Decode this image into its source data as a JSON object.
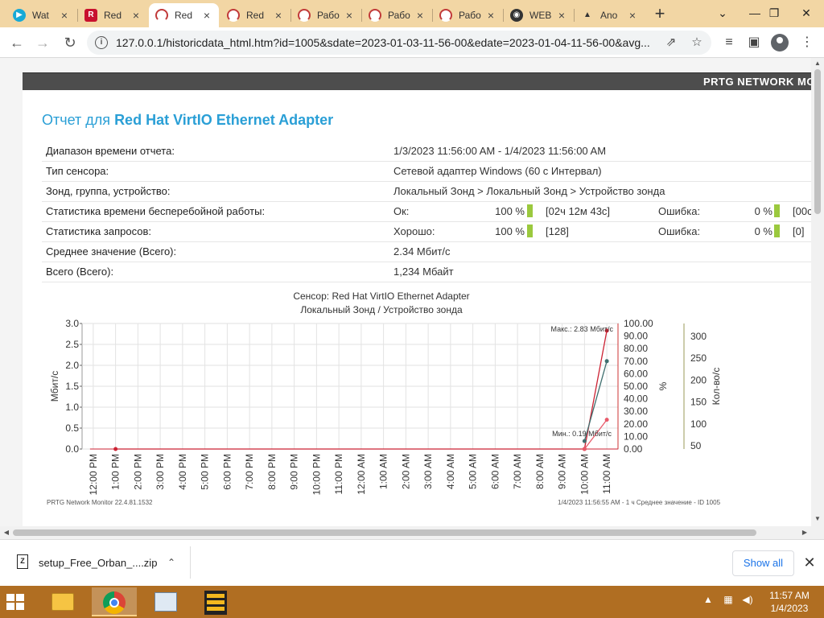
{
  "browser": {
    "tabs": [
      {
        "title": "Wat",
        "icon": "water-icon"
      },
      {
        "title": "Red",
        "icon": "redhat-icon"
      },
      {
        "title": "Red",
        "icon": "prtg-gauge-icon",
        "active": true
      },
      {
        "title": "Red",
        "icon": "prtg-gauge-icon"
      },
      {
        "title": "Рабо",
        "icon": "prtg-gauge-icon"
      },
      {
        "title": "Рабо",
        "icon": "prtg-gauge-icon"
      },
      {
        "title": "Рабо",
        "icon": "prtg-gauge-icon"
      },
      {
        "title": "WEB",
        "icon": "eye-icon"
      },
      {
        "title": "Ano",
        "icon": "triangle-logo-icon"
      }
    ],
    "url": "127.0.0.1/historicdata_html.htm?id=1005&sdate=2023-01-03-11-56-00&edate=2023-01-04-11-56-00&avg..."
  },
  "page": {
    "brand": "PRTG NETWORK MO",
    "title_prefix": "Отчет для",
    "title_name": "Red Hat VirtIO Ethernet Adapter",
    "rows": {
      "time_range": {
        "label": "Диапазон времени отчета:",
        "value": "1/3/2023 11:56:00 AM - 1/4/2023 11:56:00 AM"
      },
      "sensor_type": {
        "label": "Тип сенсора:",
        "value": "Сетевой адаптер Windows (60 с Интервал)"
      },
      "probe": {
        "label": "Зонд, группа, устройство:",
        "value": "Локальный Зонд > Локальный Зонд > Устройство зонда"
      },
      "uptime": {
        "label": "Статистика времени бесперебойной работы:",
        "ok_label": "Ок:",
        "ok_pct": "100 %",
        "ok_time": "[02ч 12м 43с]",
        "err_label": "Ошибка:",
        "err_pct": "0 %",
        "err_time": "[00с"
      },
      "requests": {
        "label": "Статистика запросов:",
        "ok_label": "Хорошо:",
        "ok_pct": "100 %",
        "ok_count": "[128]",
        "err_label": "Ошибка:",
        "err_pct": "0 %",
        "err_count": "[0]"
      },
      "average": {
        "label": "Среднее значение (Всего):",
        "value": "2.34 Мбит/с"
      },
      "total": {
        "label": "Всего (Всего):",
        "value": "1,234 Мбайт"
      }
    },
    "chart_title_1": "Сенсор: Red Hat VirtIO Ethernet Adapter",
    "chart_title_2": "Локальный Зонд / Устройство зонда",
    "footer_left": "PRTG Network Monitor 22.4.81.1532",
    "footer_right": "1/4/2023 11:56:55 AM - 1 ч Среднее значение - ID 1005"
  },
  "chart_data": {
    "type": "line",
    "categories": [
      "12:00 PM",
      "1:00 PM",
      "2:00 PM",
      "3:00 PM",
      "4:00 PM",
      "5:00 PM",
      "6:00 PM",
      "7:00 PM",
      "8:00 PM",
      "9:00 PM",
      "10:00 PM",
      "11:00 PM",
      "12:00 AM",
      "1:00 AM",
      "2:00 AM",
      "3:00 AM",
      "4:00 AM",
      "5:00 AM",
      "6:00 AM",
      "7:00 AM",
      "8:00 AM",
      "9:00 AM",
      "10:00 AM",
      "11:00 AM"
    ],
    "axes": {
      "left": {
        "label": "Мбит/с",
        "ylim": [
          0,
          3.0
        ],
        "ticks": [
          "0.0",
          "0.5",
          "1.0",
          "1.5",
          "2.0",
          "2.5",
          "3.0"
        ]
      },
      "right_pct": {
        "label": "%",
        "ylim": [
          0,
          100
        ],
        "ticks": [
          "0.00",
          "10.00",
          "20.00",
          "30.00",
          "40.00",
          "50.00",
          "60.00",
          "70.00",
          "80.00",
          "90.00",
          "100.00"
        ]
      },
      "right_count": {
        "label": "Кол-во/с",
        "ticks": [
          "50",
          "100",
          "150",
          "200",
          "250",
          "300"
        ]
      }
    },
    "series": [
      {
        "name": "",
        "color": "#cc2233",
        "values": [
          null,
          0.0,
          null,
          null,
          null,
          null,
          null,
          null,
          null,
          null,
          null,
          null,
          null,
          null,
          null,
          null,
          null,
          null,
          null,
          null,
          null,
          null,
          0.0,
          2.83
        ]
      },
      {
        "name": "",
        "color": "#3f6f6f",
        "values": [
          null,
          null,
          null,
          null,
          null,
          null,
          null,
          null,
          null,
          null,
          null,
          null,
          null,
          null,
          null,
          null,
          null,
          null,
          null,
          null,
          null,
          null,
          0.19,
          2.1
        ]
      },
      {
        "name": "",
        "color": "#e85a6a",
        "values": [
          null,
          null,
          null,
          null,
          null,
          null,
          null,
          null,
          null,
          null,
          null,
          null,
          null,
          null,
          null,
          null,
          null,
          null,
          null,
          null,
          null,
          null,
          0.0,
          0.7
        ]
      }
    ],
    "annotations": {
      "max": "Макс.: 2.83 Мбит/с",
      "min": "Мин.: 0.19 Мбит/с"
    },
    "grid": true
  },
  "downloads": {
    "file": "setup_Free_Orban_....zip",
    "show_all": "Show all"
  },
  "taskbar": {
    "time": "11:57 AM",
    "date": "1/4/2023"
  }
}
